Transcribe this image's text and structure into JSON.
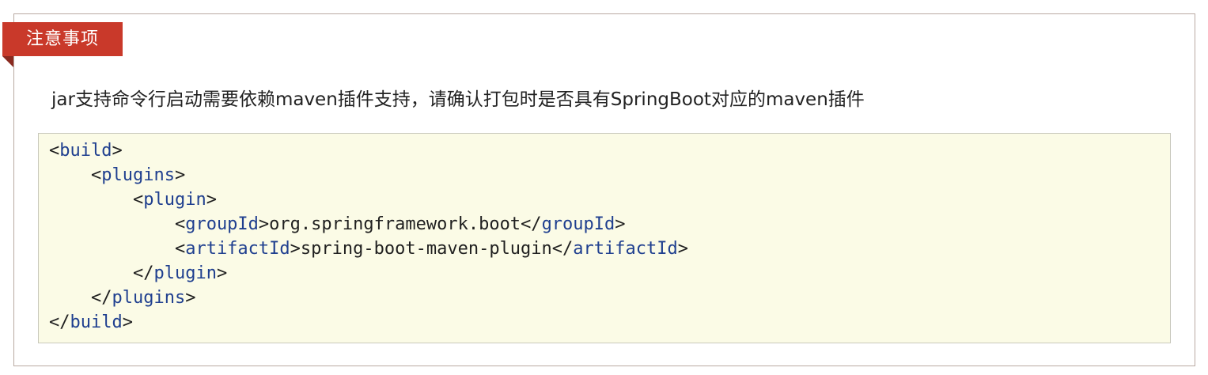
{
  "note": {
    "tag_label": "注意事项",
    "text": "jar支持命令行启动需要依赖maven插件支持，请确认打包时是否具有SpringBoot对应的maven插件"
  },
  "code": {
    "lines": [
      {
        "indent": "",
        "open": "<",
        "tag": "build",
        "close": ">",
        "value": "",
        "end_open": "",
        "end_tag": "",
        "end_close": ""
      },
      {
        "indent": "    ",
        "open": "<",
        "tag": "plugins",
        "close": ">",
        "value": "",
        "end_open": "",
        "end_tag": "",
        "end_close": ""
      },
      {
        "indent": "        ",
        "open": "<",
        "tag": "plugin",
        "close": ">",
        "value": "",
        "end_open": "",
        "end_tag": "",
        "end_close": ""
      },
      {
        "indent": "            ",
        "open": "<",
        "tag": "groupId",
        "close": ">",
        "value": "org.springframework.boot",
        "end_open": "</",
        "end_tag": "groupId",
        "end_close": ">"
      },
      {
        "indent": "            ",
        "open": "<",
        "tag": "artifactId",
        "close": ">",
        "value": "spring-boot-maven-plugin",
        "end_open": "</",
        "end_tag": "artifactId",
        "end_close": ">"
      },
      {
        "indent": "        ",
        "open": "</",
        "tag": "plugin",
        "close": ">",
        "value": "",
        "end_open": "",
        "end_tag": "",
        "end_close": ""
      },
      {
        "indent": "    ",
        "open": "</",
        "tag": "plugins",
        "close": ">",
        "value": "",
        "end_open": "",
        "end_tag": "",
        "end_close": ""
      },
      {
        "indent": "",
        "open": "</",
        "tag": "build",
        "close": ">",
        "value": "",
        "end_open": "",
        "end_tag": "",
        "end_close": ""
      }
    ]
  },
  "colors": {
    "tag_background": "#c9392a",
    "code_background": "#fbfbe6",
    "xml_tag": "#1f3f8f"
  }
}
